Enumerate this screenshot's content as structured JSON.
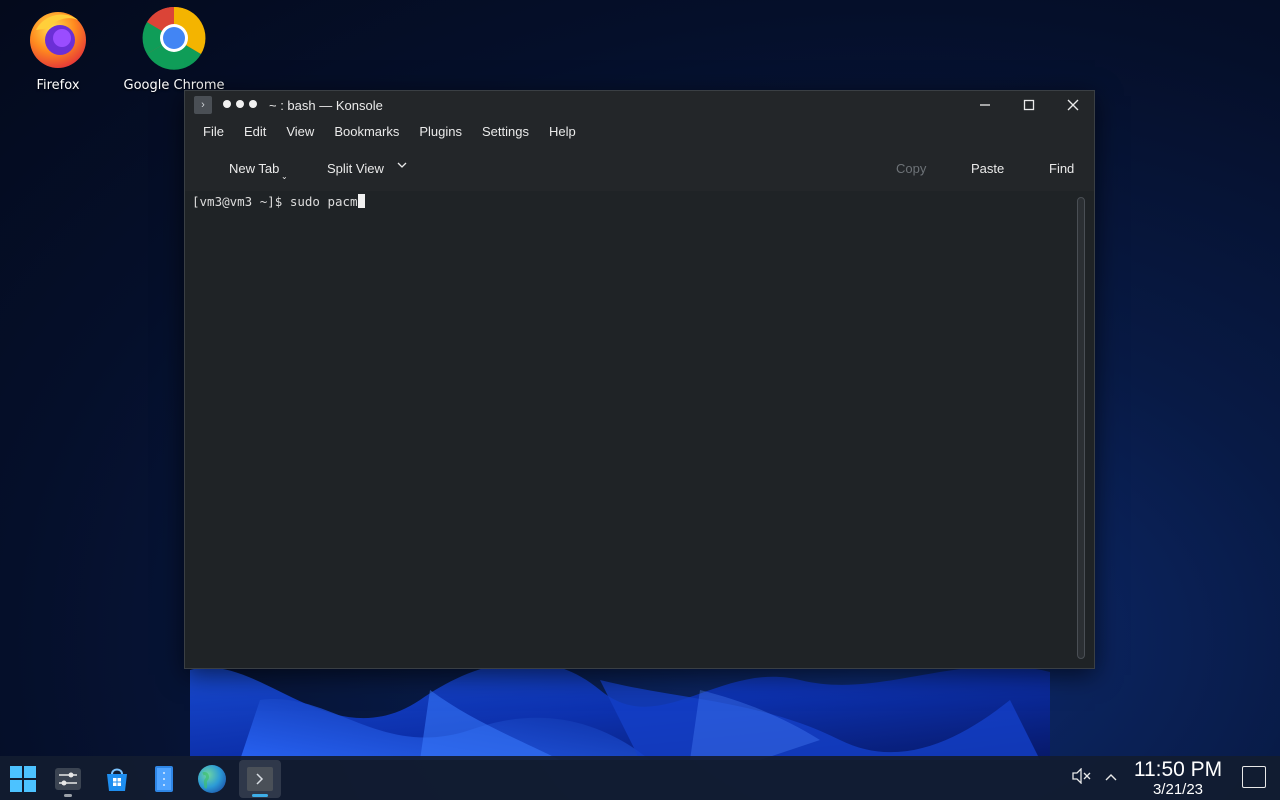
{
  "desktop": {
    "icons": [
      {
        "label": "Firefox",
        "icon": "firefox-icon"
      },
      {
        "label": "Google Chrome",
        "icon": "chrome-icon"
      }
    ]
  },
  "window": {
    "title": "~ : bash — Konsole",
    "menu": [
      "File",
      "Edit",
      "View",
      "Bookmarks",
      "Plugins",
      "Settings",
      "Help"
    ],
    "toolbar": {
      "new_tab": "New Tab",
      "split_view": "Split View",
      "copy": "Copy",
      "paste": "Paste",
      "find": "Find"
    },
    "terminal": {
      "prompt": "[vm3@vm3 ~]$ ",
      "input": "sudo pacm"
    }
  },
  "taskbar": {
    "items": [
      "start-menu-icon",
      "system-settings-icon",
      "app-store-icon",
      "file-manager-icon",
      "browser-icon",
      "konsole-icon"
    ],
    "clock": {
      "time": "11:50 PM",
      "date": "3/21/23"
    }
  },
  "colors": {
    "accent": "#3daee9",
    "window_bg": "#232629",
    "terminal_bg": "#1f2326"
  }
}
